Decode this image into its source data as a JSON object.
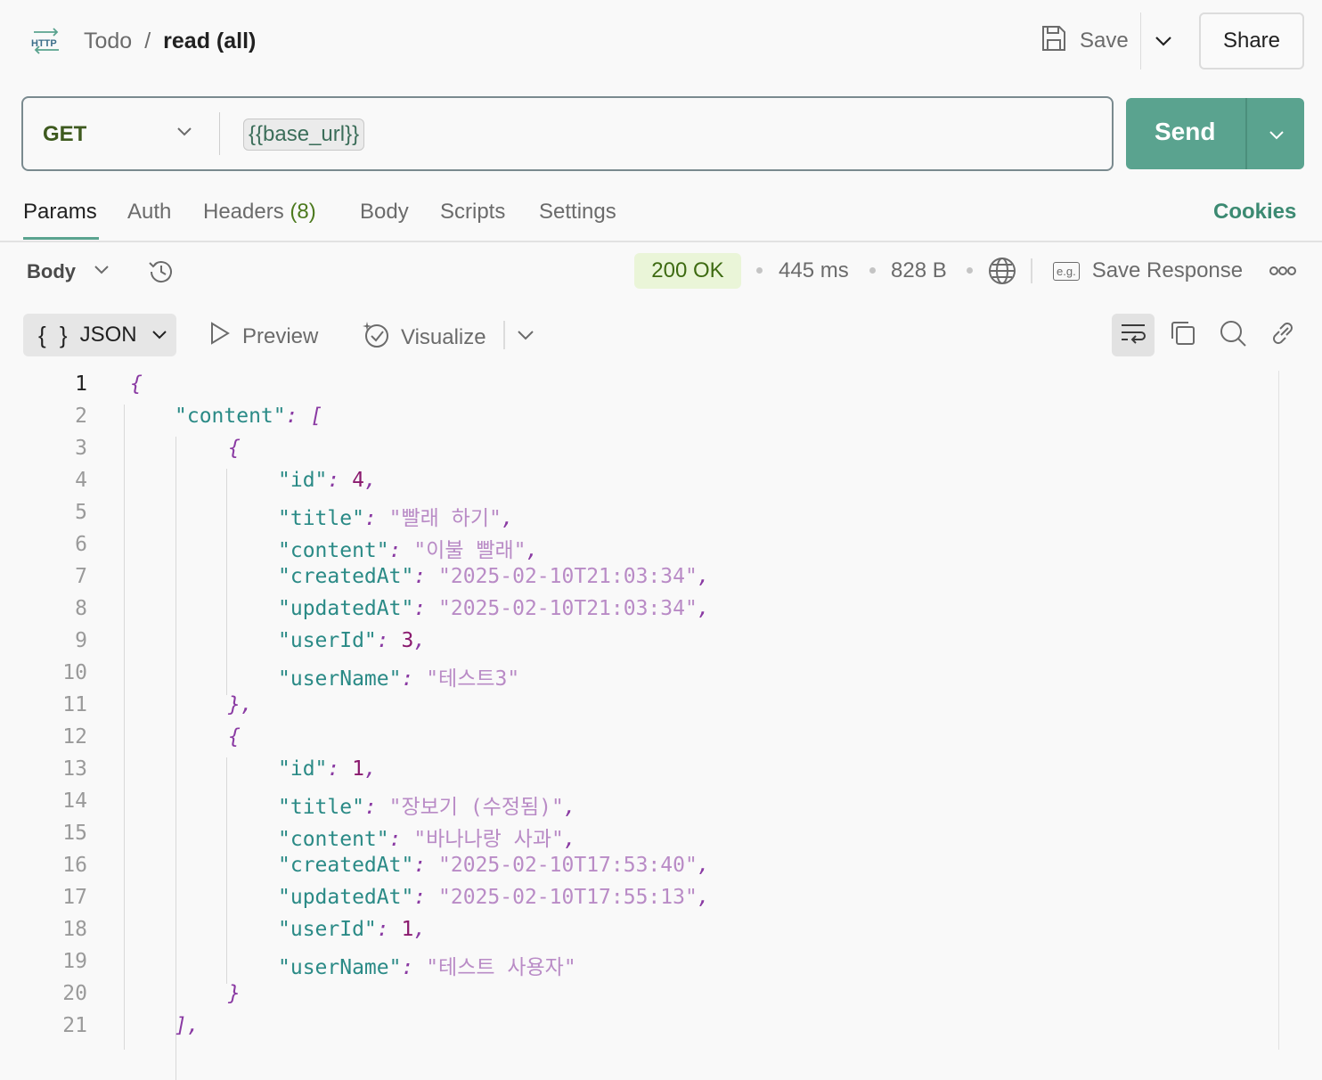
{
  "header": {
    "http_icon": "http-icon",
    "collection": "Todo",
    "separator": "/",
    "request_name": "read (all)",
    "save_label": "Save",
    "share_label": "Share"
  },
  "request": {
    "method": "GET",
    "url_variable": "{{base_url}}",
    "send_label": "Send"
  },
  "tabs": [
    {
      "label": "Params",
      "active": true
    },
    {
      "label": "Auth"
    },
    {
      "label": "Headers",
      "count": "(8)"
    },
    {
      "label": "Body"
    },
    {
      "label": "Scripts"
    },
    {
      "label": "Settings"
    }
  ],
  "cookies_label": "Cookies",
  "response": {
    "body_label": "Body",
    "status": "200 OK",
    "time": "445 ms",
    "size": "828 B",
    "save_response_label": "Save Response",
    "format_label": "JSON",
    "format_icon_text": "{ }",
    "preview_label": "Preview",
    "visualize_label": "Visualize",
    "eg_label": "e.g."
  },
  "colors": {
    "accent": "#5aa38f",
    "status_bg": "#eaf5d8",
    "status_text": "#3e6b12",
    "json_key": "#2a8a86",
    "json_string": "#b98bc6",
    "json_number": "#8a1a6e"
  },
  "code_lines": [
    {
      "n": "1",
      "text": "{"
    },
    {
      "n": "2",
      "text": "\"content\": ["
    },
    {
      "n": "3",
      "text": "{"
    },
    {
      "n": "4",
      "key": "\"id\"",
      "num": "4",
      "tail": ","
    },
    {
      "n": "5",
      "key": "\"title\"",
      "str": "\"빨래 하기\"",
      "tail": ","
    },
    {
      "n": "6",
      "key": "\"content\"",
      "str": "\"이불 빨래\"",
      "tail": ","
    },
    {
      "n": "7",
      "key": "\"createdAt\"",
      "str": "\"2025-02-10T21:03:34\"",
      "tail": ","
    },
    {
      "n": "8",
      "key": "\"updatedAt\"",
      "str": "\"2025-02-10T21:03:34\"",
      "tail": ","
    },
    {
      "n": "9",
      "key": "\"userId\"",
      "num": "3",
      "tail": ","
    },
    {
      "n": "10",
      "key": "\"userName\"",
      "str": "\"테스트3\"",
      "tail": ""
    },
    {
      "n": "11",
      "text": "},"
    },
    {
      "n": "12",
      "text": "{"
    },
    {
      "n": "13",
      "key": "\"id\"",
      "num": "1",
      "tail": ","
    },
    {
      "n": "14",
      "key": "\"title\"",
      "str": "\"장보기 (수정됨)\"",
      "tail": ","
    },
    {
      "n": "15",
      "key": "\"content\"",
      "str": "\"바나나랑 사과\"",
      "tail": ","
    },
    {
      "n": "16",
      "key": "\"createdAt\"",
      "str": "\"2025-02-10T17:53:40\"",
      "tail": ","
    },
    {
      "n": "17",
      "key": "\"updatedAt\"",
      "str": "\"2025-02-10T17:55:13\"",
      "tail": ","
    },
    {
      "n": "18",
      "key": "\"userId\"",
      "num": "1",
      "tail": ","
    },
    {
      "n": "19",
      "key": "\"userName\"",
      "str": "\"테스트 사용자\"",
      "tail": ""
    },
    {
      "n": "20",
      "text": "}"
    },
    {
      "n": "21",
      "text": "],"
    }
  ]
}
